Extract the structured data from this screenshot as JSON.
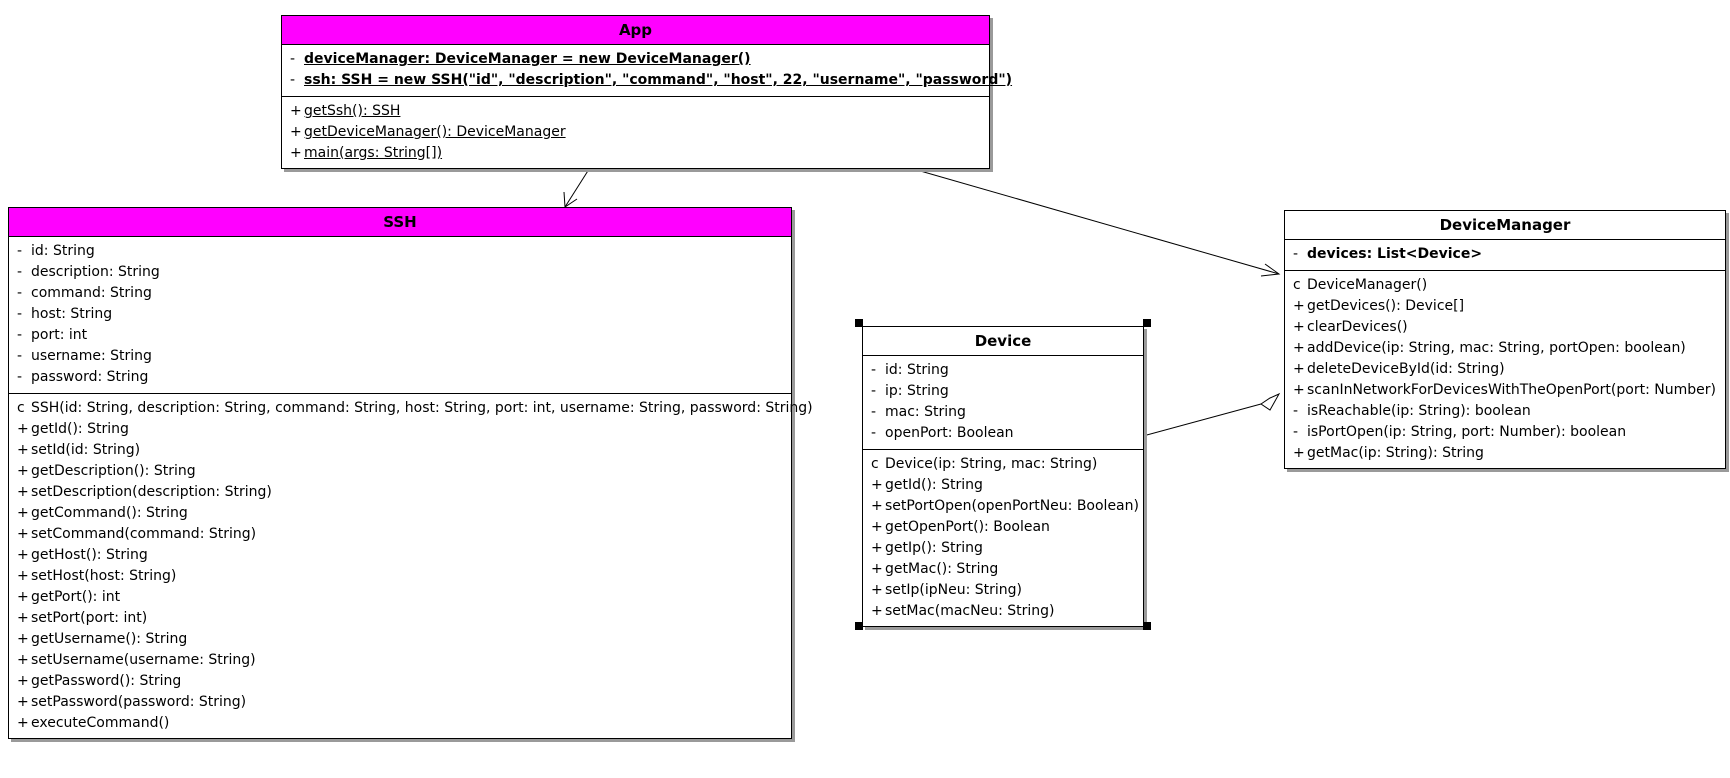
{
  "classes": {
    "app": {
      "name": "App",
      "attributes": [
        {
          "vis": "-",
          "text": "deviceManager: DeviceManager = new DeviceManager()"
        },
        {
          "vis": "-",
          "text": "ssh: SSH = new SSH(\"id\", \"description\", \"command\", \"host\", 22, \"username\", \"password\")"
        }
      ],
      "operations": [
        {
          "vis": "+",
          "text": "getSsh(): SSH"
        },
        {
          "vis": "+",
          "text": "getDeviceManager(): DeviceManager"
        },
        {
          "vis": "+",
          "text": "main(args: String[])"
        }
      ]
    },
    "ssh": {
      "name": "SSH",
      "attributes": [
        {
          "vis": "-",
          "text": "id: String"
        },
        {
          "vis": "-",
          "text": "description: String"
        },
        {
          "vis": "-",
          "text": "command: String"
        },
        {
          "vis": "-",
          "text": "host: String"
        },
        {
          "vis": "-",
          "text": "port: int"
        },
        {
          "vis": "-",
          "text": "username: String"
        },
        {
          "vis": "-",
          "text": "password: String"
        }
      ],
      "operations": [
        {
          "vis": "c",
          "text": "SSH(id: String, description: String, command: String, host: String, port: int, username: String, password: String)"
        },
        {
          "vis": "+",
          "text": "getId(): String"
        },
        {
          "vis": "+",
          "text": "setId(id: String)"
        },
        {
          "vis": "+",
          "text": "getDescription(): String"
        },
        {
          "vis": "+",
          "text": "setDescription(description: String)"
        },
        {
          "vis": "+",
          "text": "getCommand(): String"
        },
        {
          "vis": "+",
          "text": "setCommand(command: String)"
        },
        {
          "vis": "+",
          "text": "getHost(): String"
        },
        {
          "vis": "+",
          "text": "setHost(host: String)"
        },
        {
          "vis": "+",
          "text": "getPort(): int"
        },
        {
          "vis": "+",
          "text": "setPort(port: int)"
        },
        {
          "vis": "+",
          "text": "getUsername(): String"
        },
        {
          "vis": "+",
          "text": "setUsername(username: String)"
        },
        {
          "vis": "+",
          "text": "getPassword(): String"
        },
        {
          "vis": "+",
          "text": "setPassword(password: String)"
        },
        {
          "vis": "+",
          "text": "executeCommand()"
        }
      ]
    },
    "device": {
      "name": "Device",
      "attributes": [
        {
          "vis": "-",
          "text": "id: String"
        },
        {
          "vis": "-",
          "text": "ip: String"
        },
        {
          "vis": "-",
          "text": "mac: String"
        },
        {
          "vis": "-",
          "text": "openPort: Boolean"
        }
      ],
      "operations": [
        {
          "vis": "c",
          "text": "Device(ip: String, mac: String)"
        },
        {
          "vis": "+",
          "text": "getId(): String"
        },
        {
          "vis": "+",
          "text": "setPortOpen(openPortNeu: Boolean)"
        },
        {
          "vis": "+",
          "text": "getOpenPort(): Boolean"
        },
        {
          "vis": "+",
          "text": "getIp(): String"
        },
        {
          "vis": "+",
          "text": "getMac(): String"
        },
        {
          "vis": "+",
          "text": "setIp(ipNeu: String)"
        },
        {
          "vis": "+",
          "text": "setMac(macNeu: String)"
        }
      ]
    },
    "devicemanager": {
      "name": "DeviceManager",
      "attributes": [
        {
          "vis": "-",
          "text": "devices: List<Device>"
        }
      ],
      "operations": [
        {
          "vis": "c",
          "text": "DeviceManager()"
        },
        {
          "vis": "+",
          "text": "getDevices(): Device[]"
        },
        {
          "vis": "+",
          "text": "clearDevices()"
        },
        {
          "vis": "+",
          "text": "addDevice(ip: String, mac: String, portOpen: boolean)"
        },
        {
          "vis": "+",
          "text": "deleteDeviceById(id: String)"
        },
        {
          "vis": "+",
          "text": "scanInNetworkForDevicesWithTheOpenPort(port: Number)"
        },
        {
          "vis": "-",
          "text": "isReachable(ip: String): boolean"
        },
        {
          "vis": "-",
          "text": "isPortOpen(ip: String, port: Number): boolean"
        },
        {
          "vis": "+",
          "text": "getMac(ip: String): String"
        }
      ]
    }
  },
  "colors": {
    "header_highlight": "#ff00ff",
    "border": "#000000",
    "shadow": "#9a9a9a"
  }
}
